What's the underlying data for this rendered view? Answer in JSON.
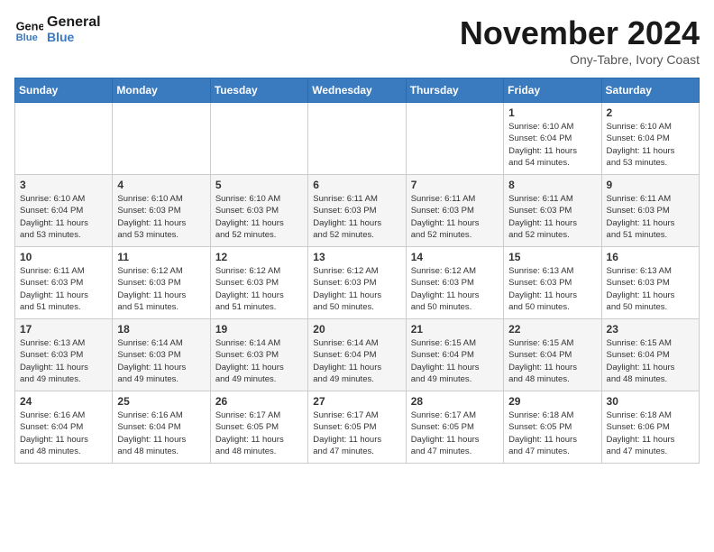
{
  "header": {
    "logo_line1": "General",
    "logo_line2": "Blue",
    "month_title": "November 2024",
    "subtitle": "Ony-Tabre, Ivory Coast"
  },
  "calendar": {
    "days_of_week": [
      "Sunday",
      "Monday",
      "Tuesday",
      "Wednesday",
      "Thursday",
      "Friday",
      "Saturday"
    ],
    "weeks": [
      [
        {
          "day": "",
          "info": ""
        },
        {
          "day": "",
          "info": ""
        },
        {
          "day": "",
          "info": ""
        },
        {
          "day": "",
          "info": ""
        },
        {
          "day": "",
          "info": ""
        },
        {
          "day": "1",
          "info": "Sunrise: 6:10 AM\nSunset: 6:04 PM\nDaylight: 11 hours\nand 54 minutes."
        },
        {
          "day": "2",
          "info": "Sunrise: 6:10 AM\nSunset: 6:04 PM\nDaylight: 11 hours\nand 53 minutes."
        }
      ],
      [
        {
          "day": "3",
          "info": "Sunrise: 6:10 AM\nSunset: 6:04 PM\nDaylight: 11 hours\nand 53 minutes."
        },
        {
          "day": "4",
          "info": "Sunrise: 6:10 AM\nSunset: 6:03 PM\nDaylight: 11 hours\nand 53 minutes."
        },
        {
          "day": "5",
          "info": "Sunrise: 6:10 AM\nSunset: 6:03 PM\nDaylight: 11 hours\nand 52 minutes."
        },
        {
          "day": "6",
          "info": "Sunrise: 6:11 AM\nSunset: 6:03 PM\nDaylight: 11 hours\nand 52 minutes."
        },
        {
          "day": "7",
          "info": "Sunrise: 6:11 AM\nSunset: 6:03 PM\nDaylight: 11 hours\nand 52 minutes."
        },
        {
          "day": "8",
          "info": "Sunrise: 6:11 AM\nSunset: 6:03 PM\nDaylight: 11 hours\nand 52 minutes."
        },
        {
          "day": "9",
          "info": "Sunrise: 6:11 AM\nSunset: 6:03 PM\nDaylight: 11 hours\nand 51 minutes."
        }
      ],
      [
        {
          "day": "10",
          "info": "Sunrise: 6:11 AM\nSunset: 6:03 PM\nDaylight: 11 hours\nand 51 minutes."
        },
        {
          "day": "11",
          "info": "Sunrise: 6:12 AM\nSunset: 6:03 PM\nDaylight: 11 hours\nand 51 minutes."
        },
        {
          "day": "12",
          "info": "Sunrise: 6:12 AM\nSunset: 6:03 PM\nDaylight: 11 hours\nand 51 minutes."
        },
        {
          "day": "13",
          "info": "Sunrise: 6:12 AM\nSunset: 6:03 PM\nDaylight: 11 hours\nand 50 minutes."
        },
        {
          "day": "14",
          "info": "Sunrise: 6:12 AM\nSunset: 6:03 PM\nDaylight: 11 hours\nand 50 minutes."
        },
        {
          "day": "15",
          "info": "Sunrise: 6:13 AM\nSunset: 6:03 PM\nDaylight: 11 hours\nand 50 minutes."
        },
        {
          "day": "16",
          "info": "Sunrise: 6:13 AM\nSunset: 6:03 PM\nDaylight: 11 hours\nand 50 minutes."
        }
      ],
      [
        {
          "day": "17",
          "info": "Sunrise: 6:13 AM\nSunset: 6:03 PM\nDaylight: 11 hours\nand 49 minutes."
        },
        {
          "day": "18",
          "info": "Sunrise: 6:14 AM\nSunset: 6:03 PM\nDaylight: 11 hours\nand 49 minutes."
        },
        {
          "day": "19",
          "info": "Sunrise: 6:14 AM\nSunset: 6:03 PM\nDaylight: 11 hours\nand 49 minutes."
        },
        {
          "day": "20",
          "info": "Sunrise: 6:14 AM\nSunset: 6:04 PM\nDaylight: 11 hours\nand 49 minutes."
        },
        {
          "day": "21",
          "info": "Sunrise: 6:15 AM\nSunset: 6:04 PM\nDaylight: 11 hours\nand 49 minutes."
        },
        {
          "day": "22",
          "info": "Sunrise: 6:15 AM\nSunset: 6:04 PM\nDaylight: 11 hours\nand 48 minutes."
        },
        {
          "day": "23",
          "info": "Sunrise: 6:15 AM\nSunset: 6:04 PM\nDaylight: 11 hours\nand 48 minutes."
        }
      ],
      [
        {
          "day": "24",
          "info": "Sunrise: 6:16 AM\nSunset: 6:04 PM\nDaylight: 11 hours\nand 48 minutes."
        },
        {
          "day": "25",
          "info": "Sunrise: 6:16 AM\nSunset: 6:04 PM\nDaylight: 11 hours\nand 48 minutes."
        },
        {
          "day": "26",
          "info": "Sunrise: 6:17 AM\nSunset: 6:05 PM\nDaylight: 11 hours\nand 48 minutes."
        },
        {
          "day": "27",
          "info": "Sunrise: 6:17 AM\nSunset: 6:05 PM\nDaylight: 11 hours\nand 47 minutes."
        },
        {
          "day": "28",
          "info": "Sunrise: 6:17 AM\nSunset: 6:05 PM\nDaylight: 11 hours\nand 47 minutes."
        },
        {
          "day": "29",
          "info": "Sunrise: 6:18 AM\nSunset: 6:05 PM\nDaylight: 11 hours\nand 47 minutes."
        },
        {
          "day": "30",
          "info": "Sunrise: 6:18 AM\nSunset: 6:06 PM\nDaylight: 11 hours\nand 47 minutes."
        }
      ]
    ]
  }
}
